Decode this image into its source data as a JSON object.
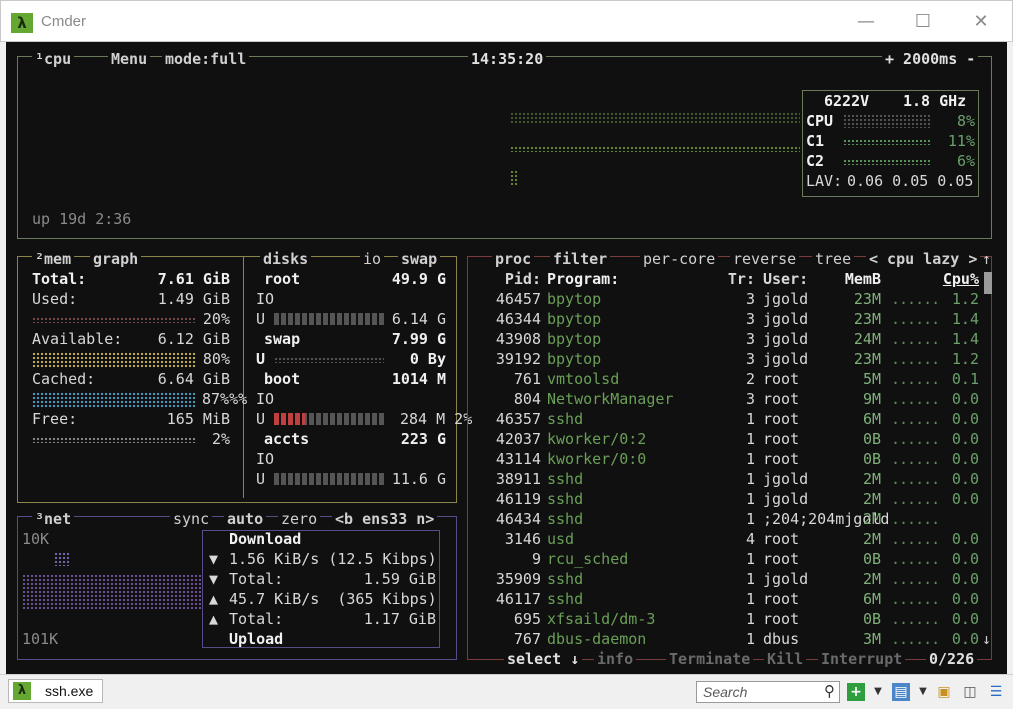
{
  "window": {
    "title": "Cmder",
    "icon": "lambda-icon",
    "controls": [
      "minimize",
      "maximize",
      "close"
    ]
  },
  "cpu_pane": {
    "label": "¹cpu",
    "menu": "Menu",
    "mode": "mode:full",
    "clock": "14:35:20",
    "interval": "+ 2000ms -",
    "uptime": "up 19d 2:36",
    "model": "6222V",
    "freq": "1.8 GHz",
    "rows": [
      {
        "name": "CPU",
        "pct": "8%"
      },
      {
        "name": "C1",
        "pct": "11%"
      },
      {
        "name": "C2",
        "pct": "6%"
      }
    ],
    "lav_label": "LAV:",
    "lav": "0.06 0.05 0.05"
  },
  "mem_pane": {
    "label": "²mem",
    "graph": "graph",
    "rows": [
      {
        "label": "Total:",
        "value": "7.61 GiB",
        "pct": ""
      },
      {
        "label": "Used:",
        "value": "1.49 GiB",
        "pct": "20%"
      },
      {
        "label": "Available:",
        "value": "6.12 GiB",
        "pct": "80%"
      },
      {
        "label": "Cached:",
        "value": "6.64 GiB",
        "pct": "87%%%"
      },
      {
        "label": "Free:",
        "value": "165 MiB",
        "pct": "2%"
      }
    ],
    "colors": {
      "used": "#7a4a4a",
      "available": "#c8b050",
      "cached": "#4aa0c8",
      "free": "#8a8a8a"
    }
  },
  "disks_pane": {
    "label": "disks",
    "io": "io",
    "swap": "swap",
    "disks": [
      {
        "name": "root",
        "size": "49.9 G",
        "io": "IO",
        "used": "6.14 G",
        "used_pct": 0
      },
      {
        "name": "swap",
        "size": "7.99 G",
        "io": "U",
        "used": "0 By",
        "used_pct": 0
      },
      {
        "name": "boot",
        "size": "1014 M",
        "io": "IO",
        "used": "284 M 2%",
        "used_pct": 0.28
      },
      {
        "name": "accts",
        "size": "223 G",
        "io": "IO",
        "used": "11.6 G",
        "used_pct": 0
      }
    ],
    "u_label": "U"
  },
  "net_pane": {
    "label": "³net",
    "sync": "sync",
    "auto": "auto",
    "zero": "zero",
    "iface": "<b ens33 n>",
    "scale_top": "10K",
    "scale_bottom": "101K",
    "download_label": "Download",
    "upload_label": "Upload",
    "down_rate": "1.56 KiB/s (12.5 Kibps)",
    "down_total_label": "Total:",
    "down_total": "1.59 GiB",
    "up_rate": "45.7 KiB/s  (365 Kibps)",
    "up_total_label": "Total:",
    "up_total": "1.17 GiB"
  },
  "proc_pane": {
    "label": "proc",
    "filter": "filter",
    "per_core": "per-core",
    "reverse": "reverse",
    "tree": "tree",
    "sort": "< cpu lazy >",
    "columns": {
      "pid": "Pid:",
      "program": "Program:",
      "tr": "Tr:",
      "user": "User:",
      "mem": "MemB",
      "cpu": "Cpu%"
    },
    "rows": [
      {
        "pid": "46457",
        "program": "bpytop",
        "tr": "3",
        "user": "jgold",
        "mem": "23M",
        "cpu": "1.2"
      },
      {
        "pid": "46344",
        "program": "bpytop",
        "tr": "3",
        "user": "jgold",
        "mem": "23M",
        "cpu": "1.4"
      },
      {
        "pid": "43908",
        "program": "bpytop",
        "tr": "3",
        "user": "jgold",
        "mem": "24M",
        "cpu": "1.4"
      },
      {
        "pid": "39192",
        "program": "bpytop",
        "tr": "3",
        "user": "jgold",
        "mem": "23M",
        "cpu": "1.2"
      },
      {
        "pid": "761",
        "program": "vmtoolsd",
        "tr": "2",
        "user": "root",
        "mem": "5M",
        "cpu": "0.1"
      },
      {
        "pid": "804",
        "program": "NetworkManager",
        "tr": "3",
        "user": "root",
        "mem": "9M",
        "cpu": "0.0"
      },
      {
        "pid": "46357",
        "program": "sshd",
        "tr": "1",
        "user": "root",
        "mem": "6M",
        "cpu": "0.0"
      },
      {
        "pid": "42037",
        "program": "kworker/0:2",
        "tr": "1",
        "user": "root",
        "mem": "0B",
        "cpu": "0.0"
      },
      {
        "pid": "43114",
        "program": "kworker/0:0",
        "tr": "1",
        "user": "root",
        "mem": "0B",
        "cpu": "0.0"
      },
      {
        "pid": "38911",
        "program": "sshd",
        "tr": "1",
        "user": "jgold",
        "mem": "2M",
        "cpu": "0.0"
      },
      {
        "pid": "46119",
        "program": "sshd",
        "tr": "1",
        "user": "jgold",
        "mem": "2M",
        "cpu": "0.0"
      },
      {
        "pid": "46434",
        "program": "sshd",
        "tr": "1",
        "user": ";204;204mjgold",
        "mem": "2M",
        "cpu": ""
      },
      {
        "pid": "3146",
        "program": "usd",
        "tr": "4",
        "user": "root",
        "mem": "2M",
        "cpu": "0.0"
      },
      {
        "pid": "9",
        "program": "rcu_sched",
        "tr": "1",
        "user": "root",
        "mem": "0B",
        "cpu": "0.0"
      },
      {
        "pid": "35909",
        "program": "sshd",
        "tr": "1",
        "user": "jgold",
        "mem": "2M",
        "cpu": "0.0"
      },
      {
        "pid": "46117",
        "program": "sshd",
        "tr": "1",
        "user": "root",
        "mem": "6M",
        "cpu": "0.0"
      },
      {
        "pid": "695",
        "program": "xfsaild/dm-3",
        "tr": "1",
        "user": "root",
        "mem": "0B",
        "cpu": "0.0"
      },
      {
        "pid": "767",
        "program": "dbus-daemon",
        "tr": "1",
        "user": "dbus",
        "mem": "3M",
        "cpu": "0.0"
      }
    ],
    "footer": {
      "select": "select ↓",
      "info": "info",
      "terminate": "Terminate",
      "kill": "Kill",
      "interrupt": "Interrupt",
      "count": "0/226"
    }
  },
  "statusbar": {
    "tab_label": "ssh.exe",
    "search_placeholder": "Search",
    "icons": [
      "search-icon",
      "new-console-icon",
      "dropdown-icon",
      "switch-console-icon",
      "dropdown-icon",
      "lock-icon",
      "split-icon",
      "menu-icon"
    ]
  },
  "colors": {
    "terminal_bg": "#101010",
    "cpu_border": "#6b7a5a",
    "mem_border": "#8c8449",
    "net_border": "#5a4c8a",
    "proc_border": "#7a3b3b",
    "proc_program": "#6a9f57",
    "cmder_green": "#64a832"
  }
}
